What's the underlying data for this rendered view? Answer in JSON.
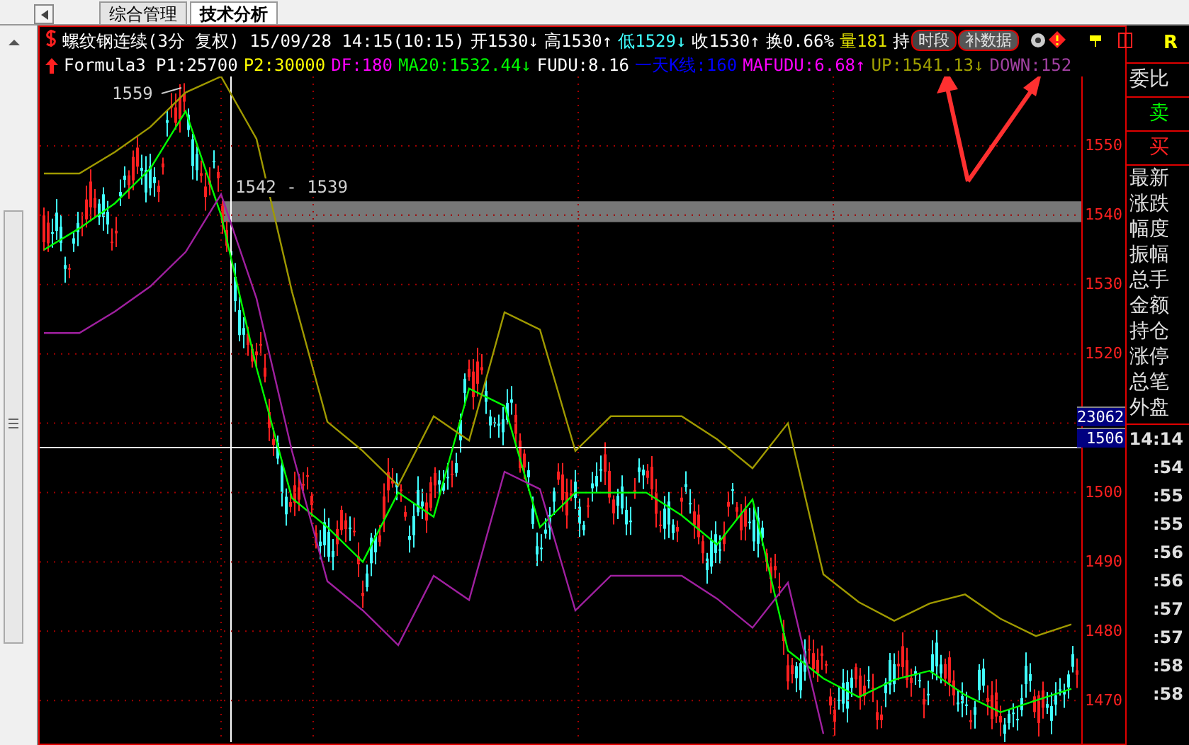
{
  "tabs": [
    {
      "label": "综合管理",
      "selected": false
    },
    {
      "label": "技术分析",
      "selected": true
    }
  ],
  "header": {
    "title": "螺纹钢连续(3分 复权) 15/09/28 14:15(10:15)",
    "quotes": [
      {
        "text": "开1530↓",
        "color": "#ffffff"
      },
      {
        "text": "高1530↑",
        "color": "#ffffff"
      },
      {
        "text": "低1529↓",
        "color": "#40ffff"
      },
      {
        "text": "收1530↑",
        "color": "#ffffff"
      },
      {
        "text": "换0.66%",
        "color": "#ffffff"
      },
      {
        "text": "量181",
        "color": "#e0e000"
      },
      {
        "text": "持",
        "color": "#ffffff"
      }
    ],
    "buttons": [
      "时段",
      "补数据"
    ],
    "indicators": [
      {
        "text": "Formula3 P1:25700",
        "color": "#ffffff"
      },
      {
        "text": "P2:30000",
        "color": "#ffff00"
      },
      {
        "text": "DF:180",
        "color": "#ff00ff"
      },
      {
        "text": "MA20:1532.44↓",
        "color": "#00ff00"
      },
      {
        "text": "FUDU:8.16",
        "color": "#ffffff"
      },
      {
        "text": "一天K线:160",
        "color": "#0000ff"
      },
      {
        "text": "MAFUDU:6.68↑",
        "color": "#ff00ff"
      },
      {
        "text": "UP:1541.13↓",
        "color": "#a0a000"
      },
      {
        "text": "DOWN:152",
        "color": "#a040a0"
      }
    ]
  },
  "chart": {
    "high_label": "1559",
    "range_label": "1542 - 1539",
    "chart_data": {
      "type": "line",
      "ylim": [
        1464,
        1560
      ],
      "grid": true,
      "yticks": [
        {
          "value": 1550,
          "label": "1550"
        },
        {
          "value": 1540,
          "label": "1540"
        },
        {
          "value": 1530,
          "label": "1530"
        },
        {
          "value": 1520,
          "label": "1520"
        },
        {
          "value": 1500,
          "label": "1500"
        },
        {
          "value": 1490,
          "label": "1490"
        },
        {
          "value": 1480,
          "label": "1480"
        },
        {
          "value": 1470,
          "label": "1470"
        }
      ],
      "series": [
        {
          "color": "#00ff00",
          "values": [
            1535,
            1538.1,
            1541.7,
            1546.7,
            1555,
            1540,
            1518,
            1499.2,
            1495,
            1490,
            1500,
            1496.5,
            1515,
            1512.5,
            1495,
            1500,
            1500,
            1500,
            1496.7,
            1492.5,
            1499,
            1477.2,
            1473.2,
            1470.5,
            1473,
            1474.3,
            1470.8,
            1468.3,
            1470,
            1471.7
          ]
        },
        {
          "color": "#a09a00",
          "values": [
            1546,
            1546,
            1549.1,
            1552.7,
            1557.7,
            1560,
            1551,
            1529,
            1510.2,
            1506,
            1501,
            1511,
            1507.5,
            1526,
            1523.5,
            1506,
            1511,
            1511,
            1511,
            1507.7,
            1503.5,
            1510,
            1488.2,
            1484.2,
            1481.5,
            1484,
            1485.3,
            1481.8,
            1479.3,
            1481
          ]
        },
        {
          "color": "#a020a0",
          "values": [
            1523,
            1523,
            1526.1,
            1529.7,
            1534.7,
            1543,
            1528,
            1506,
            1487.2,
            1483,
            1478,
            1488,
            1484.5,
            1503,
            1500.5,
            1483,
            1488,
            1488,
            1488,
            1484.7,
            1480.5,
            1487,
            1465.2,
            null,
            null,
            null,
            null,
            null,
            null,
            null
          ]
        }
      ]
    }
  },
  "cursor": {
    "volume": "23062",
    "price": "1506"
  },
  "panel": {
    "top": "R",
    "ratio": "委比",
    "sell": "卖",
    "buy": "买",
    "fields": [
      "最新",
      "涨跌",
      "幅度",
      "振幅",
      "总手",
      "金额",
      "持仓",
      "涨停",
      "总笔",
      "外盘"
    ],
    "times": [
      "14:14",
      ":54",
      ":55",
      ":55",
      ":56",
      ":56",
      ":57",
      ":57",
      ":58",
      ":58"
    ]
  }
}
